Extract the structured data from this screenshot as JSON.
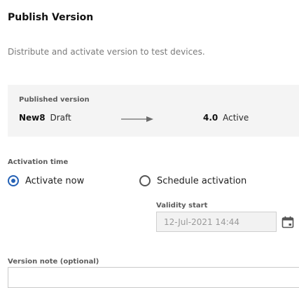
{
  "header": {
    "title": "Publish Version",
    "subtitle": "Distribute and activate version to test devices."
  },
  "published": {
    "heading": "Published version",
    "from": {
      "name": "New8",
      "status": "Draft"
    },
    "to": {
      "name": "4.0",
      "status": "Active"
    },
    "arrow_icon": "arrow-right-icon"
  },
  "activation": {
    "label": "Activation time",
    "selected": "activate_now",
    "options": [
      {
        "id": "activate_now",
        "label": "Activate now"
      },
      {
        "id": "schedule",
        "label": "Schedule activation"
      }
    ],
    "validity_label": "Validity start",
    "validity_value": "12-Jul-2021 14:44",
    "calendar_icon": "calendar-icon"
  },
  "note": {
    "label": "Version note (optional)",
    "value": ""
  },
  "colors": {
    "accent": "#2461b5",
    "panel_bg": "#f4f4f4",
    "muted_text": "#7a7a7a",
    "disabled_field_bg": "#f2f2f2"
  }
}
